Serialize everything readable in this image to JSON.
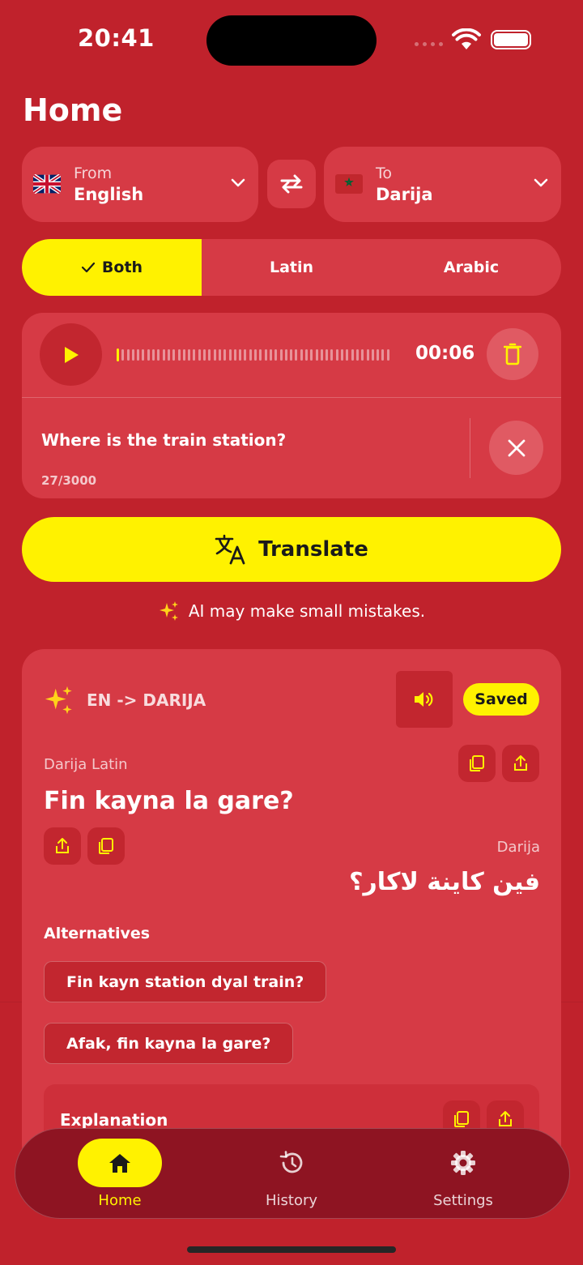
{
  "status_bar": {
    "time": "20:41"
  },
  "page": {
    "title": "Home"
  },
  "language": {
    "from_label": "From",
    "from_value": "English",
    "to_label": "To",
    "to_value": "Darija"
  },
  "script_options": [
    {
      "label": "Both",
      "active": true
    },
    {
      "label": "Latin",
      "active": false
    },
    {
      "label": "Arabic",
      "active": false
    }
  ],
  "input": {
    "recording_time": "00:06",
    "text": "Where is the train station?",
    "char_count": "27/3000"
  },
  "translate_label": "Translate",
  "disclaimer": "AI may make small mistakes.",
  "result": {
    "direction": "EN -> DARIJA",
    "saved_label": "Saved",
    "latin_label": "Darija Latin",
    "latin_text": "Fin kayna la gare?",
    "arabic_label": "Darija",
    "arabic_text": "فين كاينة لاكار؟",
    "alternatives_title": "Alternatives",
    "alternatives": [
      "Fin kayn station dyal train?",
      "Afak, fin kayna la gare?"
    ],
    "explanation_title": "Explanation"
  },
  "nav": {
    "items": [
      {
        "label": "Home",
        "icon": "home-icon",
        "active": true
      },
      {
        "label": "History",
        "icon": "history-icon",
        "active": false
      },
      {
        "label": "Settings",
        "icon": "gear-icon",
        "active": false
      }
    ]
  },
  "colors": {
    "background": "#C0222C",
    "card": "#D63A45",
    "accent_yellow": "#FFF200",
    "nav_bg": "#8E1422"
  }
}
